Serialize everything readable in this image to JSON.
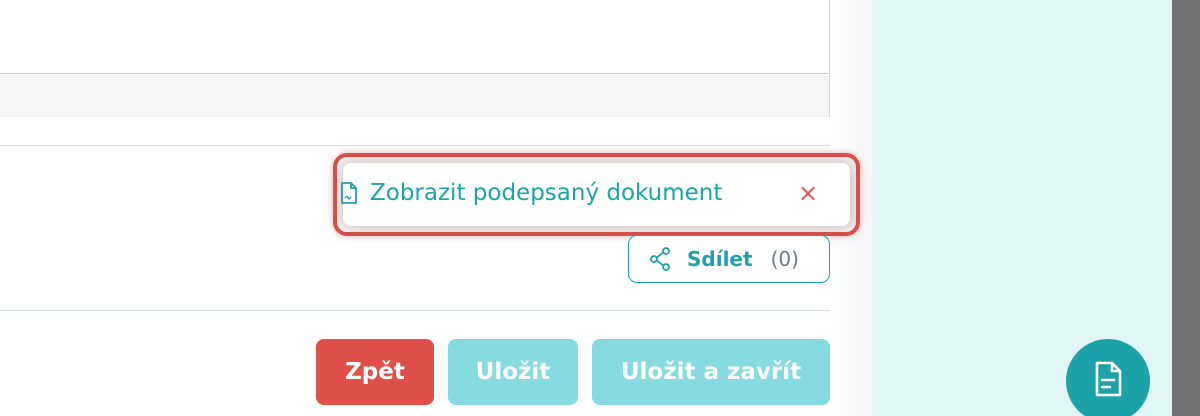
{
  "document_panel": {
    "signed_document_link": "Zobrazit podepsaný dokument",
    "close_symbol": "×",
    "link_icon": "document-icon"
  },
  "share": {
    "label": "Sdílet",
    "count": "(0)",
    "icon": "share-icon"
  },
  "actions": {
    "back_label": "Zpět",
    "save_label": "Uložit",
    "save_close_label": "Uložit a zavřít"
  },
  "fab": {
    "icon": "document-icon"
  },
  "colors": {
    "accent": "#1ba3a9",
    "danger": "#e05048",
    "disabled_accent": "#86dbe0",
    "side_panel": "#e2f5f5"
  }
}
